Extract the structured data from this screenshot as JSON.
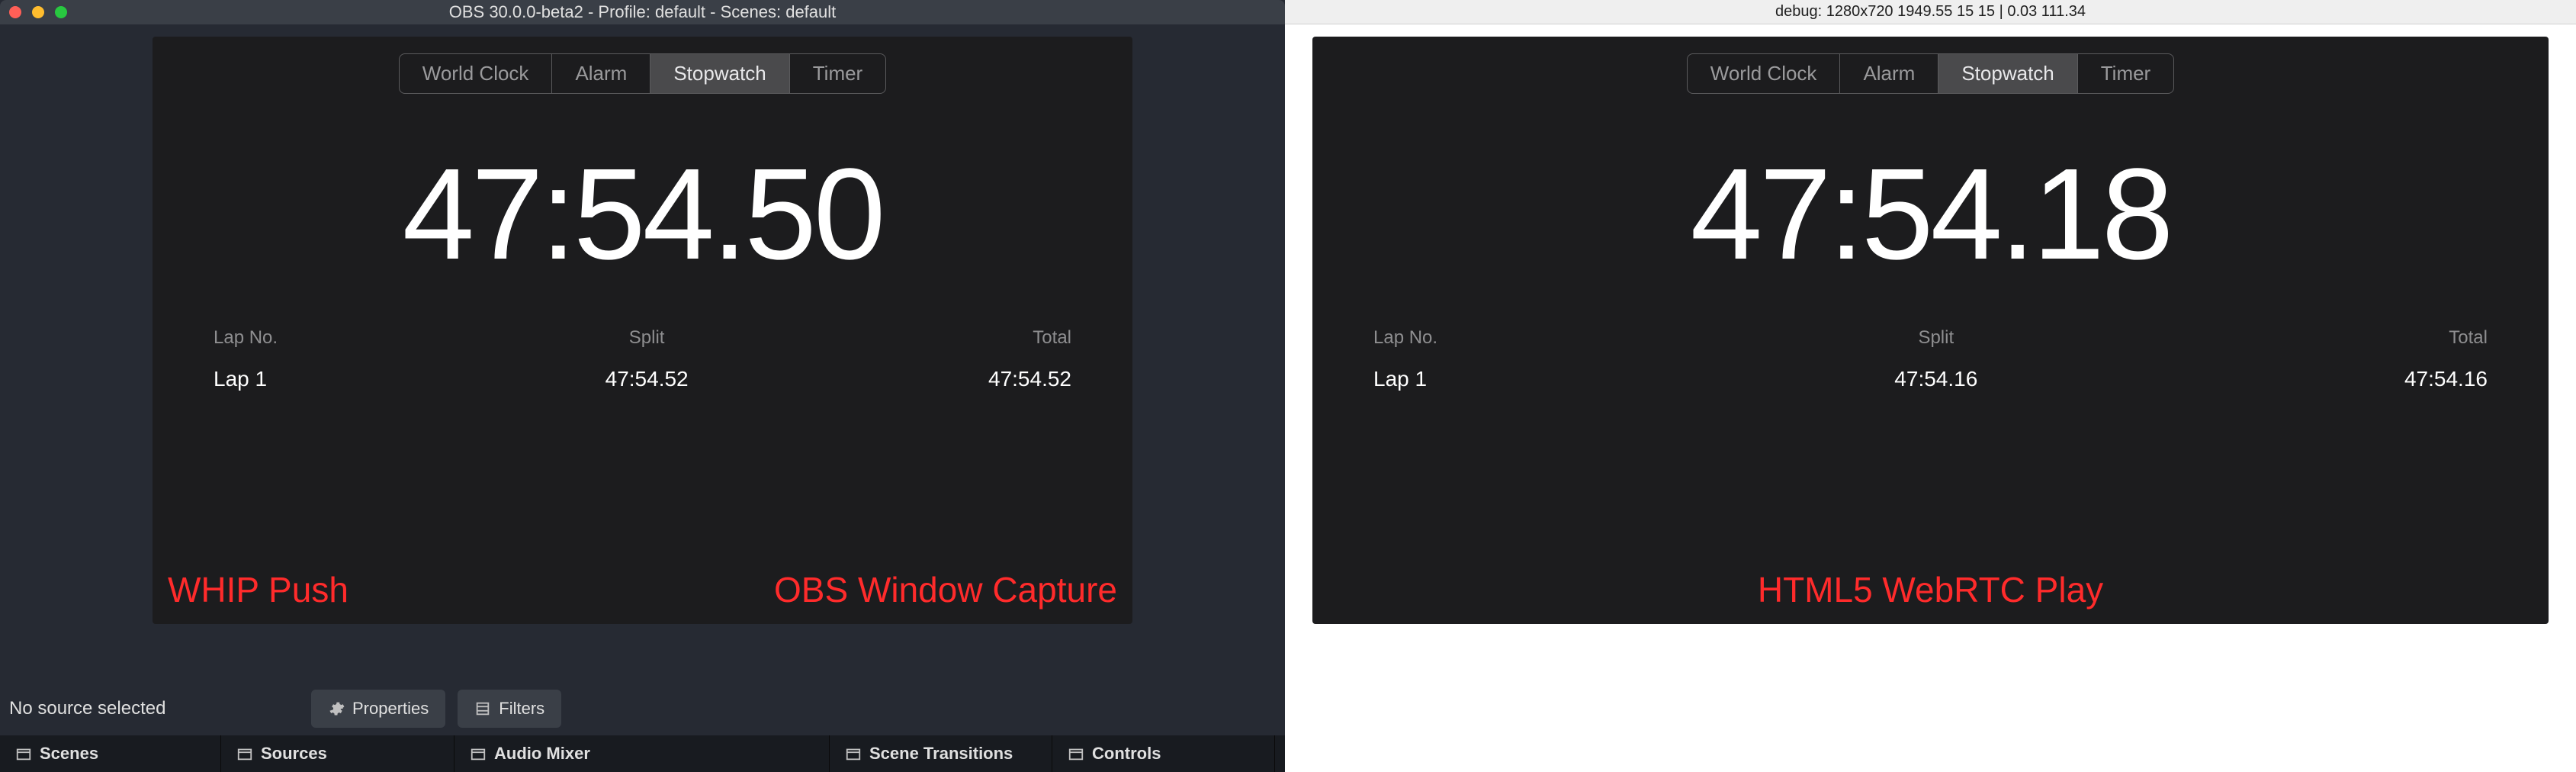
{
  "left": {
    "window_title": "OBS 30.0.0-beta2 - Profile: default - Scenes: default",
    "tabs": {
      "world_clock": "World Clock",
      "alarm": "Alarm",
      "stopwatch": "Stopwatch",
      "timer": "Timer"
    },
    "big_time": "47:54.50",
    "lap_header": {
      "no": "Lap No.",
      "split": "Split",
      "total": "Total"
    },
    "lap": {
      "no": "Lap 1",
      "split": "47:54.52",
      "total": "47:54.52"
    },
    "ann_left": "WHIP Push",
    "ann_right": "OBS Window Capture",
    "no_source": "No source selected",
    "btn_properties": "Properties",
    "btn_filters": "Filters",
    "docks": {
      "scenes": "Scenes",
      "sources": "Sources",
      "audio": "Audio Mixer",
      "transitions": "Scene Transitions",
      "controls": "Controls"
    }
  },
  "right": {
    "debug_title": "debug: 1280x720 1949.55 15 15 | 0.03 111.34",
    "tabs": {
      "world_clock": "World Clock",
      "alarm": "Alarm",
      "stopwatch": "Stopwatch",
      "timer": "Timer"
    },
    "big_time": "47:54.18",
    "lap_header": {
      "no": "Lap No.",
      "split": "Split",
      "total": "Total"
    },
    "lap": {
      "no": "Lap 1",
      "split": "47:54.16",
      "total": "47:54.16"
    },
    "ann": "HTML5 WebRTC Play"
  }
}
